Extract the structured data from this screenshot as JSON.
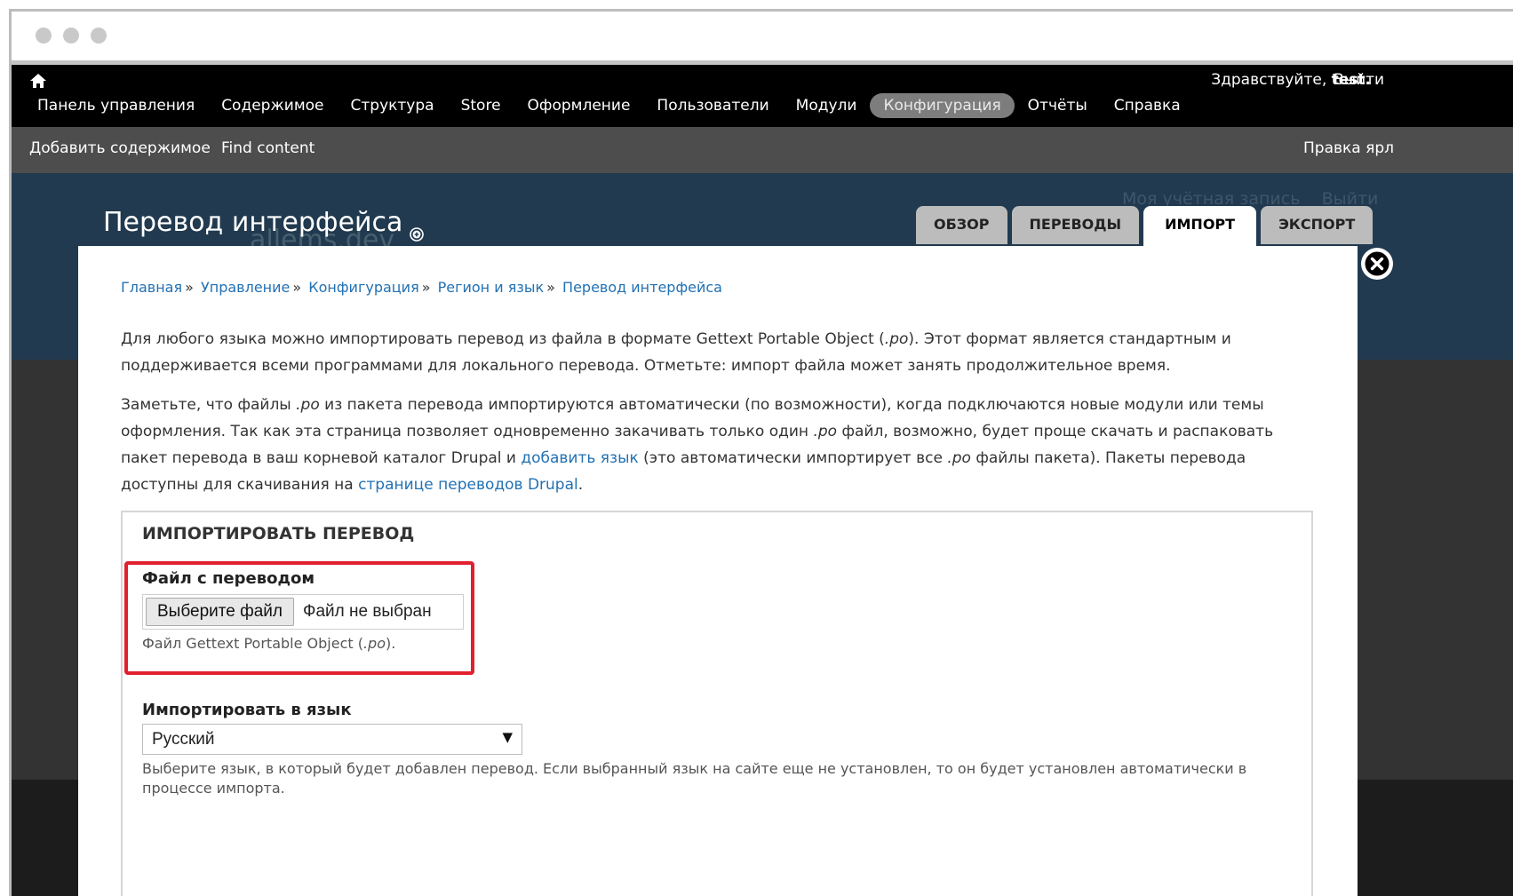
{
  "toolbar": {
    "greeting_prefix": "Здравствуйте,",
    "user": "test.",
    "logout": "Выйти",
    "menu": [
      {
        "label": "Панель управления"
      },
      {
        "label": "Содержимое"
      },
      {
        "label": "Структура"
      },
      {
        "label": "Store"
      },
      {
        "label": "Оформление"
      },
      {
        "label": "Пользователи"
      },
      {
        "label": "Модули"
      },
      {
        "label": "Конфигурация",
        "active": true
      },
      {
        "label": "Отчёты"
      },
      {
        "label": "Справка"
      }
    ]
  },
  "shortcuts": {
    "add_content": "Добавить содержимое",
    "find_content": "Find content",
    "edit_shortcuts": "Правка ярл"
  },
  "background": {
    "account_link": "Моя учётная запись",
    "logout_link": "Выйти",
    "site_name": "allems.dev"
  },
  "page": {
    "title": "Перевод интерфейса",
    "tabs": [
      "ОБЗОР",
      "ПЕРЕВОДЫ",
      "ИМПОРТ",
      "ЭКСПОРТ"
    ],
    "active_tab": "ИМПОРТ"
  },
  "breadcrumb": [
    "Главная",
    "Управление",
    "Конфигурация",
    "Регион и язык",
    "Перевод интерфейса"
  ],
  "breadcrumb_separator": "»",
  "intro": {
    "p1_a": "Для любого языка можно импортировать перевод из файла в формате Gettext Portable Object (",
    "p1_ext": ".po",
    "p1_b": "). Этот формат является стандартным и поддерживается всеми программами для локального перевода. Отметьте: импорт файла может занять продолжительное время.",
    "p2_a": "Заметьте, что файлы ",
    "p2_ext1": ".po",
    "p2_b": " из пакета перевода импортируются автоматически (по возможности), когда подключаются новые модули или темы оформления. Так как эта страница позволяет одновременно закачивать только один ",
    "p2_ext2": ".po",
    "p2_c": " файл, возможно, будет проще скачать и распаковать пакет перевода в ваш корневой каталог Drupal и ",
    "p2_link1": "добавить язык",
    "p2_d": " (это автоматически импортирует все ",
    "p2_ext3": ".po",
    "p2_e": " файлы пакета). Пакеты перевода доступны для скачивания на ",
    "p2_link2": "странице переводов Drupal",
    "p2_f": "."
  },
  "form": {
    "legend": "ИМПОРТИРОВАТЬ ПЕРЕВОД",
    "file_label": "Файл с переводом",
    "file_button": "Выберите файл",
    "file_status": "Файл не выбран",
    "file_desc_a": "Файл Gettext Portable Object (",
    "file_desc_ext": ".po",
    "file_desc_b": ").",
    "lang_label": "Импортировать в язык",
    "lang_value": "Русский",
    "lang_desc": "Выберите язык, в который будет добавлен перевод. Если выбранный язык на сайте еще не установлен, то он будет установлен автоматически в процессе импорта."
  },
  "colors": {
    "toolbar": "#000000",
    "shortcuts": "#4d4d4d",
    "link": "#2271b3",
    "highlight": "#e1202f"
  }
}
